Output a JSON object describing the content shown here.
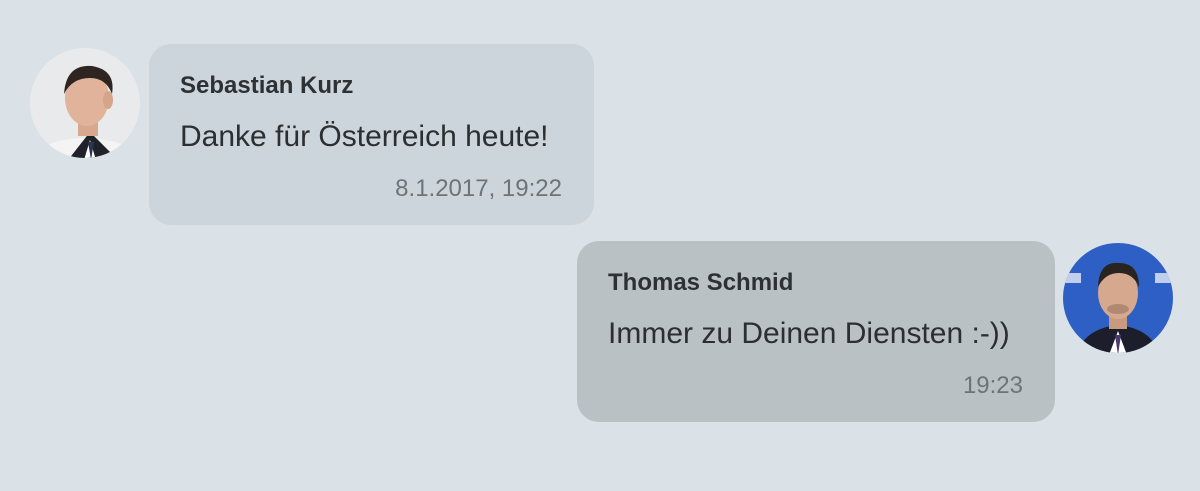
{
  "messages": [
    {
      "sender": "Sebastian Kurz",
      "text": "Danke für Österreich heute!",
      "time": "8.1.2017, 19:22",
      "side": "left"
    },
    {
      "sender": "Thomas Schmid",
      "text": "Immer zu Deinen Diensten :-))",
      "time": "19:23",
      "side": "right"
    }
  ]
}
